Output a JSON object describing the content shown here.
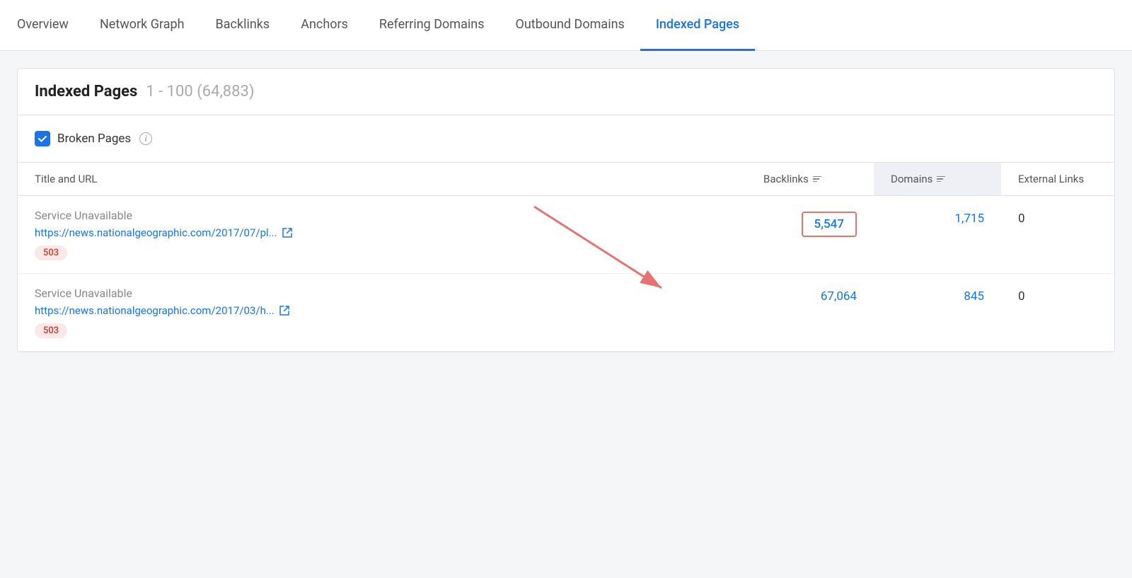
{
  "nav": {
    "items": [
      {
        "id": "overview",
        "label": "Overview",
        "active": false
      },
      {
        "id": "network-graph",
        "label": "Network Graph",
        "active": false
      },
      {
        "id": "backlinks",
        "label": "Backlinks",
        "active": false
      },
      {
        "id": "anchors",
        "label": "Anchors",
        "active": false
      },
      {
        "id": "referring-domains",
        "label": "Referring Domains",
        "active": false
      },
      {
        "id": "outbound-domains",
        "label": "Outbound Domains",
        "active": false
      },
      {
        "id": "indexed-pages",
        "label": "Indexed Pages",
        "active": true
      }
    ]
  },
  "card": {
    "title": "Indexed Pages",
    "subtitle": "1 - 100 (64,883)"
  },
  "filter": {
    "checkbox_label": "Broken Pages",
    "info_icon": "i",
    "checked": true
  },
  "table": {
    "columns": [
      {
        "id": "title-url",
        "label": "Title and URL",
        "sortable": false,
        "sorted": false
      },
      {
        "id": "backlinks",
        "label": "Backlinks",
        "sortable": true,
        "sorted": false
      },
      {
        "id": "domains",
        "label": "Domains",
        "sortable": true,
        "sorted": true
      },
      {
        "id": "external-links",
        "label": "External Links",
        "sortable": false,
        "sorted": false
      }
    ],
    "rows": [
      {
        "title": "Service Unavailable",
        "url": "https://news.nationalgeographic.com/2017/07/pl...",
        "status": "503",
        "backlinks": "5,547",
        "domains": "1,715",
        "external_links": "0",
        "highlighted": true
      },
      {
        "title": "Service Unavailable",
        "url": "https://news.nationalgeographic.com/2017/03/h...",
        "status": "503",
        "backlinks": "67,064",
        "domains": "845",
        "external_links": "0",
        "highlighted": false
      }
    ]
  },
  "colors": {
    "blue": "#1a73e8",
    "red_border": "#e57373",
    "badge_bg": "#fde8e8",
    "badge_text": "#c0392b",
    "sorted_bg": "#eef0f5",
    "arrow_color": "#e57373"
  }
}
